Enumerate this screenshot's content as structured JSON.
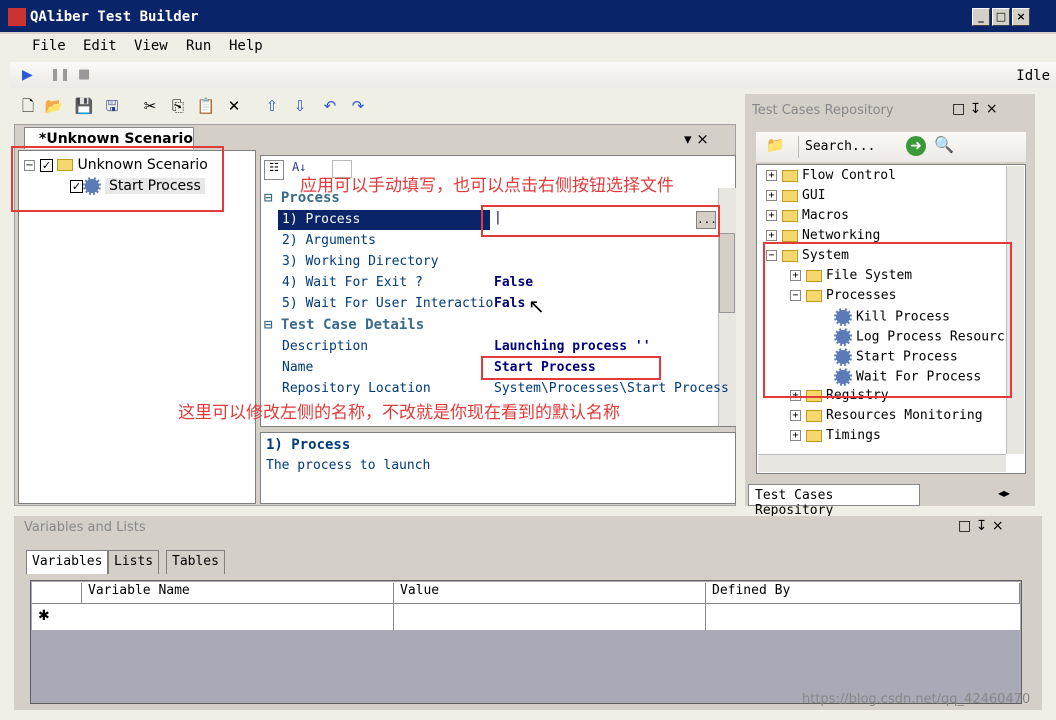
{
  "window": {
    "title": "QAliber Test Builder"
  },
  "menu": [
    {
      "label": "File"
    },
    {
      "label": "Edit"
    },
    {
      "label": "View"
    },
    {
      "label": "Run"
    },
    {
      "label": "Help"
    }
  ],
  "status": "Idle",
  "document": {
    "tab": "*Unknown Scenario",
    "close": "▾ ×"
  },
  "tree": {
    "root": "Unknown Scenario",
    "child": "Start Process"
  },
  "grid": {
    "cat1": "Process",
    "props": [
      {
        "label": "1) Process",
        "value": "|"
      },
      {
        "label": "2) Arguments",
        "value": ""
      },
      {
        "label": "3) Working Directory",
        "value": ""
      },
      {
        "label": "4) Wait For Exit ?",
        "value": "False"
      },
      {
        "label": "5) Wait For User Interactio",
        "value": "Fals"
      }
    ],
    "cat2": "Test Case Details",
    "details": [
      {
        "label": "Description",
        "value": "Launching process ''"
      },
      {
        "label": "Name",
        "value": "Start Process"
      },
      {
        "label": "Repository Location",
        "value": "System\\Processes\\Start Process"
      }
    ],
    "browse": "..."
  },
  "help": {
    "title": "1) Process",
    "text": "The process to launch"
  },
  "repo": {
    "title": "Test Cases Repository",
    "search": "Search...",
    "items": [
      "Flow Control",
      "GUI",
      "Macros",
      "Networking",
      "System",
      "File System",
      "Processes",
      "Kill Process",
      "Log Process Resourc",
      "Start Process",
      "Wait For Process",
      "Registry",
      "Resources Monitoring",
      "Timings"
    ],
    "tab": "Test Cases Repository"
  },
  "vars": {
    "title": "Variables and Lists",
    "tabs": [
      "Variables",
      "Lists",
      "Tables"
    ],
    "cols": [
      "Variable Name",
      "Value",
      "Defined By"
    ],
    "star": "✱"
  },
  "annotations": {
    "top": "应用可以手动填写，也可以点击右侧按钮选择文件",
    "middle": "这里可以修改左侧的名称，不改就是你现在看到的默认名称"
  },
  "watermark": "https://blog.csdn.net/qq_42460470"
}
